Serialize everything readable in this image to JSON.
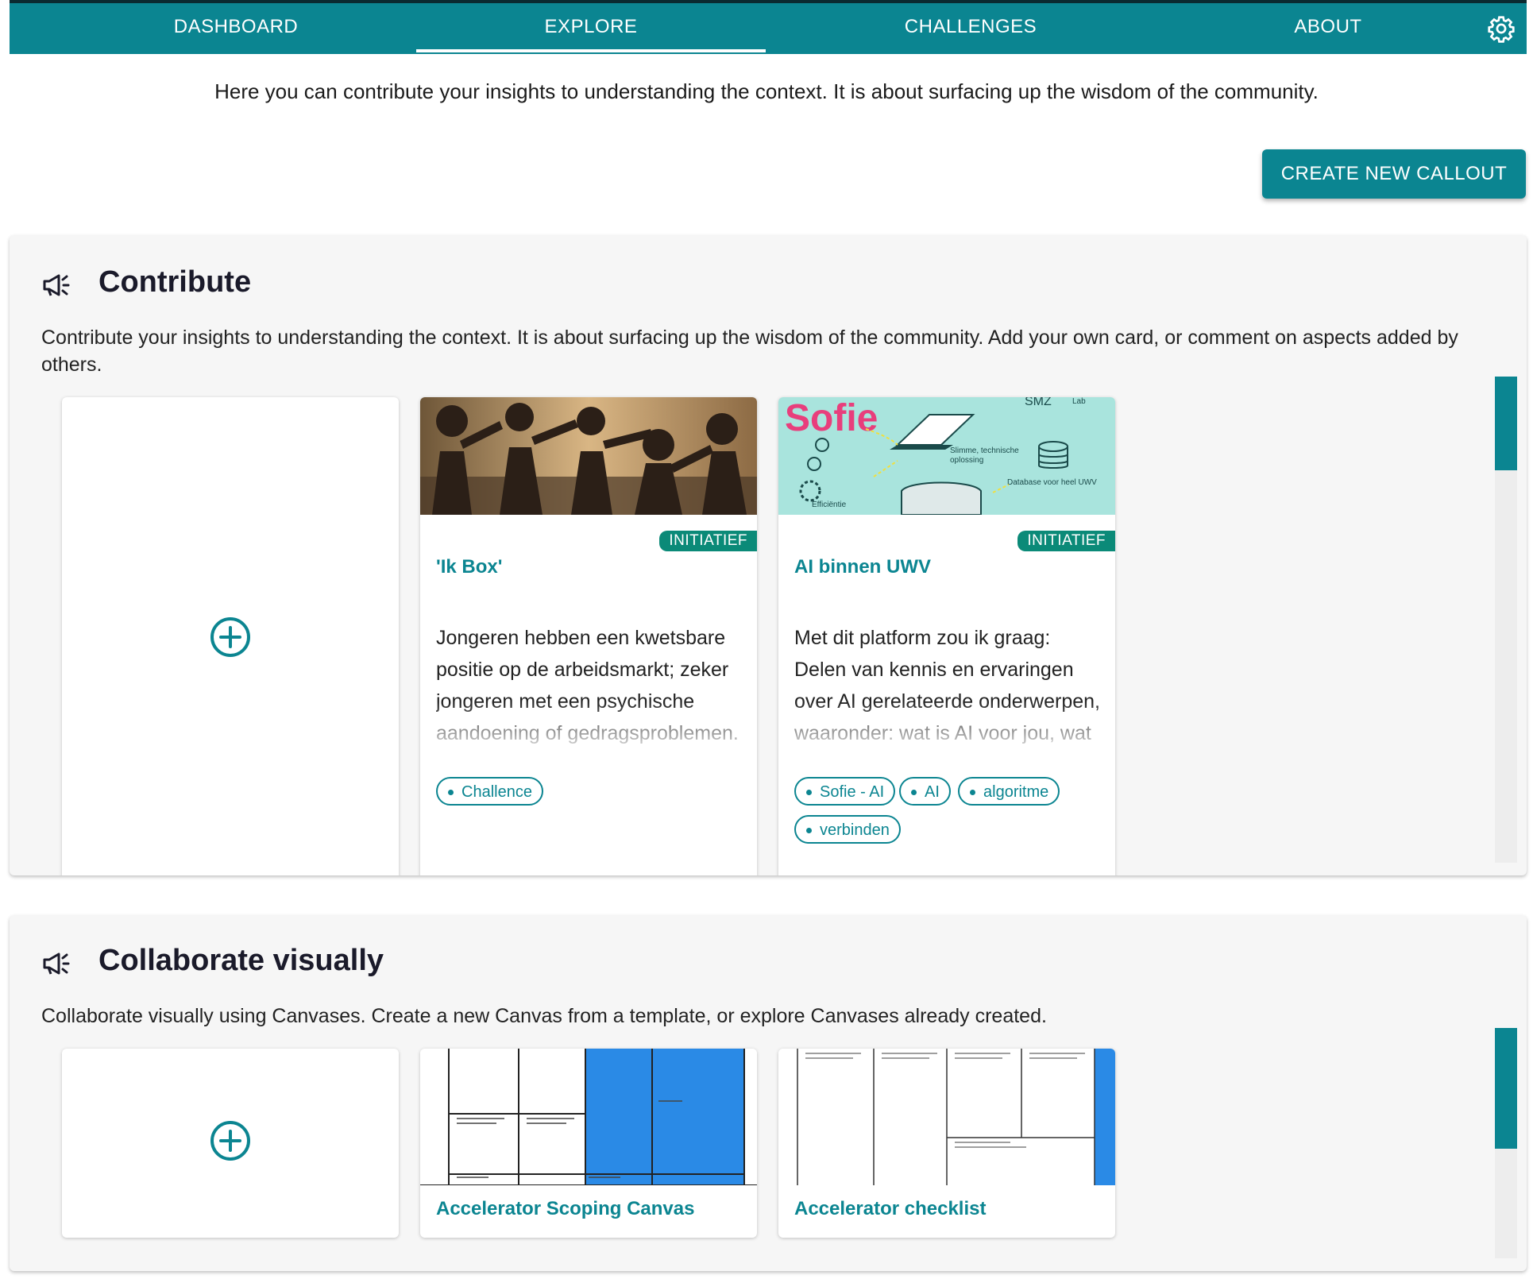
{
  "nav": {
    "tabs": [
      "DASHBOARD",
      "EXPLORE",
      "CHALLENGES",
      "ABOUT"
    ],
    "active_tab": "EXPLORE",
    "settings_icon": "gear-icon"
  },
  "intro_text": "Here you can contribute your insights to understanding the context. It is about surfacing up the wisdom of the community.",
  "create_button": "CREATE NEW CALLOUT",
  "contribute": {
    "icon": "megaphone-icon",
    "title": "Contribute",
    "description": "Contribute your insights to understanding the context. It is about surfacing up the wisdom of the community. Add your own card, or comment on aspects added by others.",
    "add_icon": "plus-circle-icon",
    "cards": [
      {
        "badge": "INITIATIEF",
        "title": "'Ik Box'",
        "body": "Jongeren hebben een kwetsbare positie op de arbeidsmarkt; zeker jongeren met een psychische aandoening of gedragsproblemen.",
        "tags": [
          "Challence"
        ]
      },
      {
        "badge": "INITIATIEF",
        "title": "AI binnen UWV",
        "body": "Met dit platform zou ik graag: Delen van kennis en ervaringen over AI gerelateerde onderwerpen, waaronder: wat is AI voor jou, wat",
        "tags": [
          "Sofie - AI",
          "AI",
          "algoritme",
          "verbinden"
        ],
        "image_text": {
          "logo": "Sofie",
          "l1": "Slimme, technische",
          "l2": "oplossing",
          "l3": "Database voor heel UWV",
          "l4": "Efficiëntie",
          "l5": "SMZ",
          "l6": "Lab"
        }
      }
    ]
  },
  "collaborate": {
    "icon": "megaphone-icon",
    "title": "Collaborate visually",
    "description": "Collaborate visually using Canvases. Create a new Canvas from a template, or explore Canvases already created.",
    "add_icon": "plus-circle-icon",
    "cards": [
      {
        "title": "Accelerator Scoping Canvas"
      },
      {
        "title": "Accelerator checklist"
      }
    ]
  },
  "colors": {
    "primary": "#0b8591",
    "badge": "#0b8a78",
    "canvas_blue": "#2a8ae6",
    "sofie_pink": "#e83e7c",
    "sofie_bg": "#a9e4dd"
  }
}
